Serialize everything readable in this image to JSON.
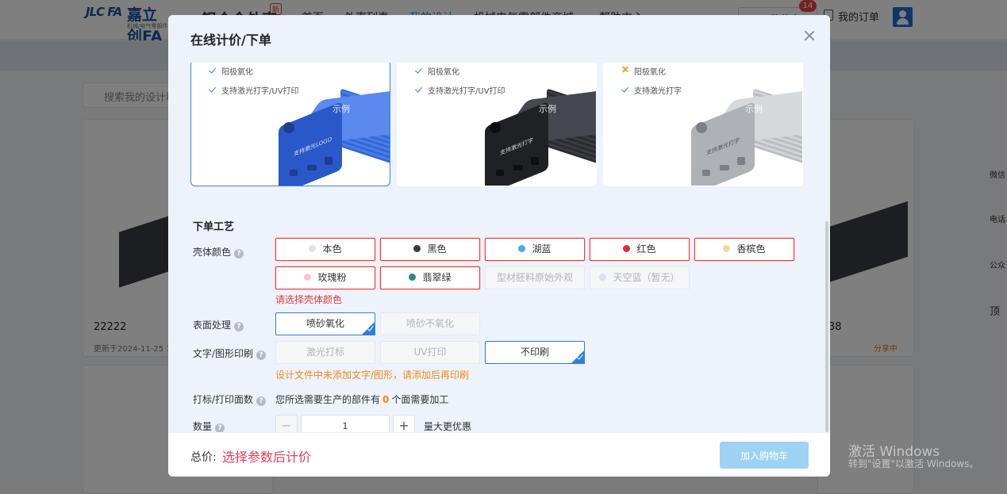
{
  "background": {
    "logo": {
      "mark": "JLC FA",
      "name": "嘉立创FA",
      "sub": "机械/电气零部件"
    },
    "site_title": "铝合金外壳",
    "new_badge": "新",
    "nav": [
      "首页",
      "外壳列表",
      "我的设计",
      "机械电气零部件商城",
      "帮助中心"
    ],
    "cart_label": "购物车",
    "cart_count": "14",
    "orders_label": "我的订单",
    "search_placeholder": "搜索我的设计稿",
    "card_left_title": "22222",
    "card_left_date": "更新于2024-11-25 1",
    "card_right_title": "38",
    "card_right_status": "分享中",
    "right_rail": [
      "微信",
      "电话",
      "公众",
      "顶"
    ]
  },
  "modal": {
    "title": "在线计价/下单",
    "samples": [
      {
        "features": [
          "阳极氧化",
          "支持激光打字/UV打印"
        ],
        "feature_marks": [
          "check",
          "check"
        ],
        "label": "示例",
        "print": "支持激光LOGO",
        "color": "#2f62d0"
      },
      {
        "features": [
          "阳极氧化",
          "支持激光打字/UV打印"
        ],
        "feature_marks": [
          "check",
          "check"
        ],
        "label": "示例",
        "print": "支持激光打字",
        "color": "#2b2d31"
      },
      {
        "features": [
          "阳极氧化",
          "支持激光打字"
        ],
        "feature_marks": [
          "cross",
          "check"
        ],
        "label": "示例",
        "print": "支持激光打字",
        "color": "#bfc2c6"
      }
    ],
    "section_title": "下单工艺",
    "color_label": "壳体颜色",
    "colors": [
      {
        "label": "本色",
        "swatch": "#e3e3e3",
        "state": "error"
      },
      {
        "label": "黑色",
        "swatch": "#3b3b3b",
        "state": "error"
      },
      {
        "label": "湖蓝",
        "swatch": "#4aa8ef",
        "state": "error"
      },
      {
        "label": "红色",
        "swatch": "#dd2c3f",
        "state": "error"
      },
      {
        "label": "香槟色",
        "swatch": "#f7d79c",
        "state": "error"
      },
      {
        "label": "玫瑰粉",
        "swatch": "#f7c2de",
        "state": "error"
      },
      {
        "label": "翡翠绿",
        "swatch": "#2f8a79",
        "state": "error"
      },
      {
        "label": "型材胚料原始外观",
        "swatch": "",
        "state": "disabled"
      },
      {
        "label": "天空蓝（暂无）",
        "swatch": "#d5e3f3",
        "state": "disabled"
      }
    ],
    "color_error": "请选择壳体颜色",
    "surface_label": "表面处理",
    "surface_options": [
      {
        "label": "喷砂氧化",
        "state": "selected"
      },
      {
        "label": "喷砂不氧化",
        "state": "disabled"
      }
    ],
    "print_label": "文字/图形印刷",
    "print_options": [
      {
        "label": "激光打标",
        "state": "disabled"
      },
      {
        "label": "UV打印",
        "state": "disabled"
      },
      {
        "label": "不印刷",
        "state": "selected"
      }
    ],
    "print_warning": "设计文件中未添加文字/图形，请添加后再印刷",
    "faces_label": "打标/打印面数",
    "faces_prefix": "您所选需要生产的部件有",
    "faces_count": "0",
    "faces_suffix": "个面需要加工",
    "qty_label": "数量",
    "qty_value": "1",
    "qty_minus": "−",
    "qty_plus": "+",
    "qty_tip": "量大更优惠",
    "total_label": "总价:",
    "total_value": "选择参数后计价",
    "add_cart": "加入购物车"
  },
  "watermark": {
    "line1": "激活 Windows",
    "line2": "转到\"设置\"以激活 Windows。"
  },
  "colors": {
    "accent": "#2f80d8",
    "error": "#ec3b3b",
    "warning": "#f08a1c",
    "price": "#ec3b5a",
    "cart_button": "#9ed2f2"
  }
}
